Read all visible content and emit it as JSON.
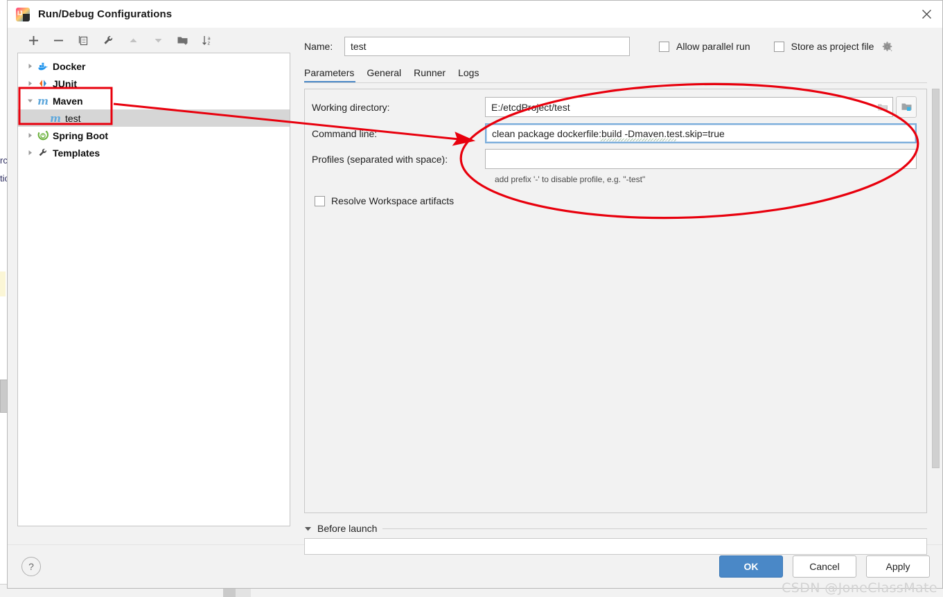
{
  "window": {
    "title": "Run/Debug Configurations",
    "app_icon": "intellij-idea-icon",
    "close_icon": "close-icon"
  },
  "tree_toolbar": {
    "buttons": [
      {
        "name": "add-configuration-button",
        "icon": "plus-icon",
        "label": "+",
        "enabled": true
      },
      {
        "name": "remove-configuration-button",
        "icon": "minus-icon",
        "label": "−",
        "enabled": true
      },
      {
        "name": "copy-configuration-button",
        "icon": "copy-icon",
        "label": "copy",
        "enabled": true
      },
      {
        "name": "edit-templates-button",
        "icon": "wrench-icon",
        "label": "wrench",
        "enabled": true
      },
      {
        "name": "move-up-button",
        "icon": "arrow-up-icon",
        "label": "up",
        "enabled": false
      },
      {
        "name": "move-down-button",
        "icon": "arrow-down-icon",
        "label": "down",
        "enabled": false
      },
      {
        "name": "new-folder-button",
        "icon": "folder-add-icon",
        "label": "folder",
        "enabled": true
      },
      {
        "name": "sort-configurations-button",
        "icon": "sort-az-icon",
        "label": "sort",
        "enabled": true
      }
    ]
  },
  "tree": {
    "items": [
      {
        "label": "Docker",
        "icon": "docker-icon",
        "level": 0,
        "expanded": false,
        "selected": false,
        "bold": true
      },
      {
        "label": "JUnit",
        "icon": "junit-icon",
        "level": 0,
        "expanded": false,
        "selected": false,
        "bold": true
      },
      {
        "label": "Maven",
        "icon": "maven-icon",
        "level": 0,
        "expanded": true,
        "selected": false,
        "bold": true
      },
      {
        "label": "test",
        "icon": "maven-icon",
        "level": 1,
        "expanded": null,
        "selected": true,
        "bold": false
      },
      {
        "label": "Spring Boot",
        "icon": "spring-boot-icon",
        "level": 0,
        "expanded": false,
        "selected": false,
        "bold": true
      },
      {
        "label": "Templates",
        "icon": "wrench-icon",
        "level": 0,
        "expanded": false,
        "selected": false,
        "bold": true
      }
    ]
  },
  "form": {
    "name_label": "Name:",
    "name_value": "test",
    "allow_parallel_run": {
      "label": "Allow parallel run",
      "checked": false
    },
    "store_as_project_file": {
      "label": "Store as project file",
      "checked": false
    },
    "gear_icon": "gear-icon"
  },
  "tabs": [
    {
      "label": "Parameters",
      "active": true
    },
    {
      "label": "General",
      "active": false
    },
    {
      "label": "Runner",
      "active": false
    },
    {
      "label": "Logs",
      "active": false
    }
  ],
  "parameters": {
    "working_directory": {
      "label": "Working directory:",
      "value": "E:/etcdProject/test",
      "browse_icon": "folder-browse-icon",
      "macro_icon": "macro-folder-icon"
    },
    "command_line": {
      "label": "Command line:",
      "value": "clean package dockerfile:build -Dmaven.test.skip=true",
      "focused": true
    },
    "profiles": {
      "label": "Profiles (separated with space):",
      "value": "",
      "hint": "add prefix '-' to disable profile, e.g. \"-test\""
    },
    "resolve_workspace_artifacts": {
      "label": "Resolve Workspace artifacts",
      "checked": false
    }
  },
  "before_launch": {
    "label": "Before launch",
    "caret_icon": "chevron-down-icon",
    "expanded": true
  },
  "footer": {
    "help_label": "?",
    "help_icon": "help-icon",
    "ok_label": "OK",
    "cancel_label": "Cancel",
    "apply_label": "Apply"
  },
  "watermark": "CSDN @JoneClassMate",
  "background": {
    "left_text_1": "rc",
    "left_text_2": "tic"
  },
  "colors": {
    "accent": "#4a88c7",
    "annotation_red": "#e8000d",
    "selection_gray": "#d6d6d6",
    "maven_blue": "#5fa8dc",
    "dialog_bg": "#f2f2f2"
  }
}
